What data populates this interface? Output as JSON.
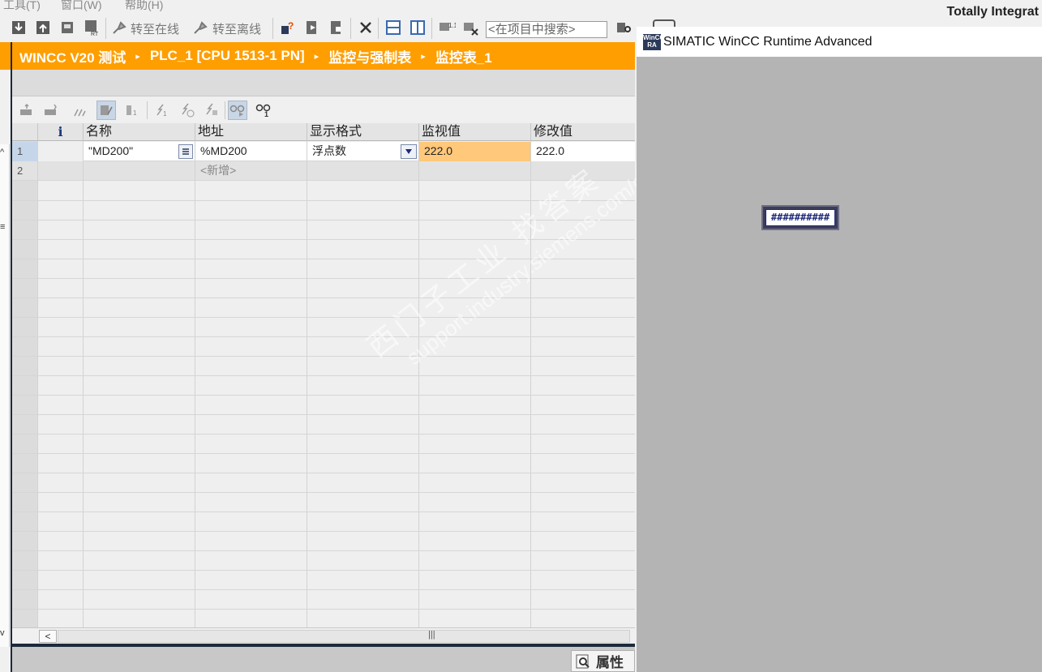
{
  "menu": {
    "items": [
      "工具(T)",
      "窗口(W)",
      "帮助(H)"
    ]
  },
  "toolbar": {
    "go_online": "转至在线",
    "go_offline": "转至离线",
    "search_placeholder": "<在项目中搜索>"
  },
  "brand": {
    "title": "Totally Integrat"
  },
  "breadcrumb": {
    "items": [
      "WINCC  V20 测试",
      "PLC_1 [CPU 1513-1 PN]",
      "监控与强制表",
      "监控表_1"
    ],
    "separator": "▸"
  },
  "table": {
    "columns": [
      "i",
      "名称",
      "地址",
      "显示格式",
      "监视值",
      "修改值"
    ],
    "rows": [
      {
        "num": "1",
        "name": "\"MD200\"",
        "address": "%MD200",
        "format": "浮点数",
        "monitor": "222.0",
        "modify": "222.0"
      },
      {
        "num": "2",
        "name": "",
        "address": "<新增>",
        "format": "",
        "monitor": "",
        "modify": ""
      }
    ],
    "monitor_highlight_color": "#ffc87a"
  },
  "properties": {
    "label": "属性"
  },
  "watermark": {
    "cn": "西门子工业  找答案",
    "url": "support.industry.siemens.com/cs"
  },
  "runtime": {
    "title": "SIMATIC WinCC Runtime Advanced",
    "icon_text": "WinCC RA",
    "io_field_value": "##########"
  },
  "colors": {
    "accent_orange": "#ff9e00",
    "runtime_bg": "#b4b4b4"
  }
}
